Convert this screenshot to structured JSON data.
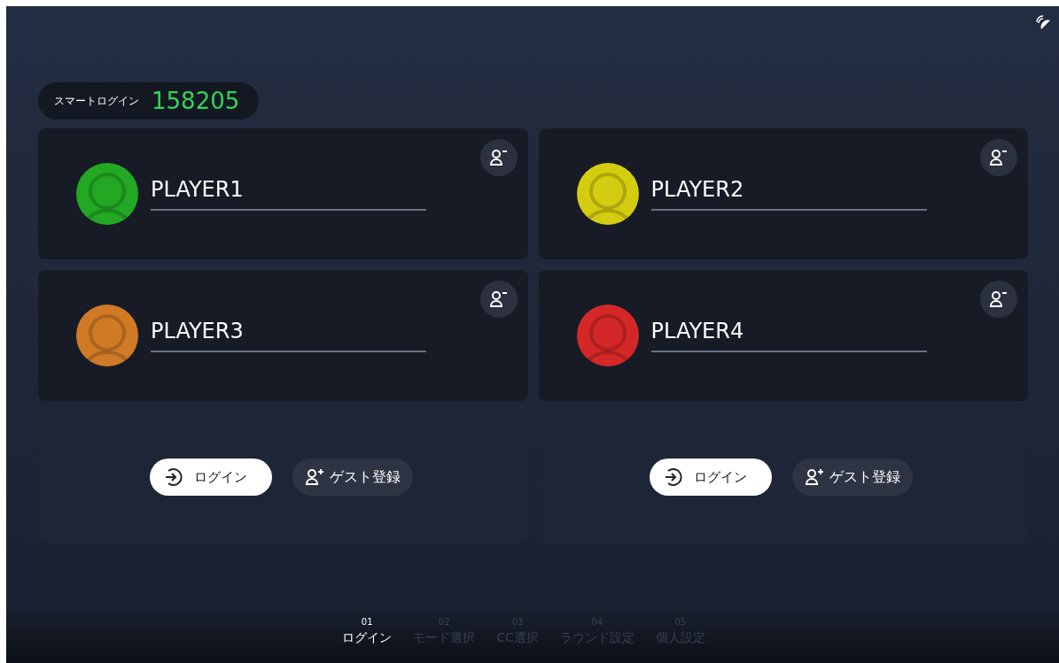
{
  "smart_login": {
    "label": "スマートログイン",
    "code": "158205"
  },
  "slots": [
    {
      "kind": "player",
      "name": "PLAYER1",
      "color": "#22a822"
    },
    {
      "kind": "player",
      "name": "PLAYER2",
      "color": "#d4cc10"
    },
    {
      "kind": "player",
      "name": "PLAYER3",
      "color": "#d07a26"
    },
    {
      "kind": "player",
      "name": "PLAYER4",
      "color": "#d42828"
    },
    {
      "kind": "empty",
      "login_label": "ログイン",
      "guest_label": "ゲスト登録"
    },
    {
      "kind": "empty",
      "login_label": "ログイン",
      "guest_label": "ゲスト登録"
    }
  ],
  "steps": [
    {
      "number": "01",
      "label": "ログイン",
      "selected": true
    },
    {
      "number": "02",
      "label": "モード選択",
      "selected": false
    },
    {
      "number": "03",
      "label": "CC選択",
      "selected": false
    },
    {
      "number": "04",
      "label": "ラウンド設定",
      "selected": false
    },
    {
      "number": "05",
      "label": "個人設定",
      "selected": false
    }
  ]
}
